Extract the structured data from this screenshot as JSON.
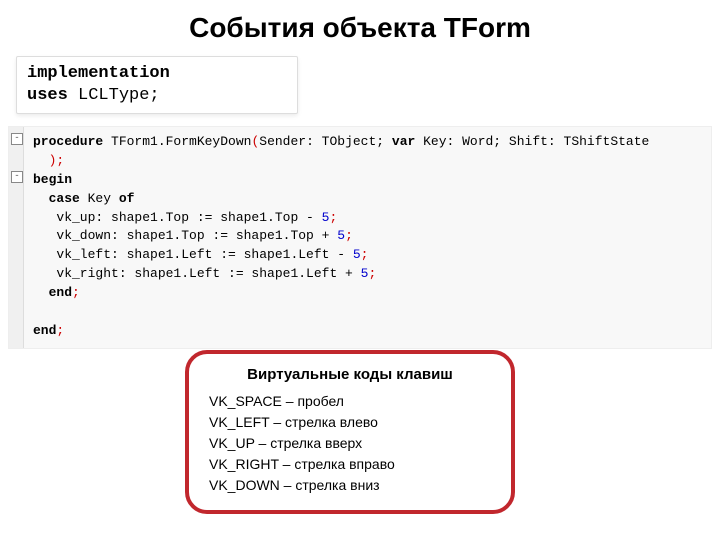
{
  "title": "События объекта TForm",
  "snippet1": {
    "line1_kw": "implementation",
    "line2_kw": "uses",
    "line2_rest": " LCLType;"
  },
  "code": {
    "l1a": "procedure",
    "l1b": " TForm1.FormKeyDown",
    "l1c": "(",
    "l1d": "Sender: TObject; ",
    "l1e": "var",
    "l1f": " Key: Word; Shift: TShiftState",
    "l2a": ")",
    "l2b": ";",
    "l3a": "begin",
    "l4a": "  case",
    "l4b": " Key ",
    "l4c": "of",
    "l5a": "   vk_up: shape1.Top := shape1.Top - ",
    "l5n": "5",
    "l5b": ";",
    "l6a": "   vk_down: shape1.Top := shape1.Top + ",
    "l6n": "5",
    "l6b": ";",
    "l7a": "   vk_left: shape1.Left := shape1.Left - ",
    "l7n": "5",
    "l7b": ";",
    "l8a": "   vk_right: shape1.Left := shape1.Left + ",
    "l8n": "5",
    "l8b": ";",
    "l9a": "  end",
    "l9b": ";",
    "l10": "",
    "l11a": "end",
    "l11b": ";"
  },
  "callout": {
    "title": "Виртуальные коды клавиш",
    "items": [
      "VK_SPACE – пробел",
      "VK_LEFT – стрелка влево",
      "VK_UP  – стрелка вверх",
      "VK_RIGHT – стрелка вправо",
      "VK_DOWN – стрелка вниз"
    ]
  }
}
